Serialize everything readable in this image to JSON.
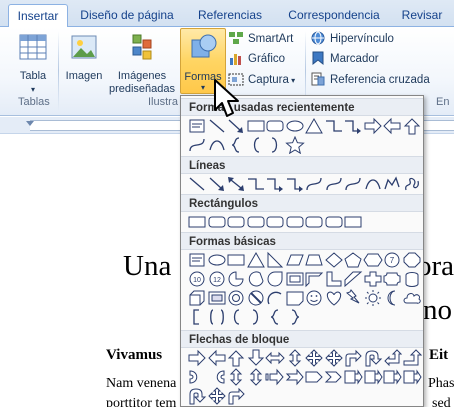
{
  "tabs": [
    {
      "label": "Insertar",
      "active": true
    },
    {
      "label": "Diseño de página"
    },
    {
      "label": "Referencias"
    },
    {
      "label": "Correspondencia"
    },
    {
      "label": "Revisar"
    }
  ],
  "ribbon": {
    "tabla": "Tabla",
    "tablas_group": "Tablas",
    "imagen": "Imagen",
    "imagenes_pred_1": "Imágenes",
    "imagenes_pred_2": "prediseñadas",
    "ilustra_group": "Ilustra",
    "formas": "Formas",
    "smartart": "SmartArt",
    "grafico": "Gráfico",
    "captura": "Captura",
    "hipervinculo": "Hipervínculo",
    "marcador": "Marcador",
    "referencia_cruzada": "Referencia cruzada",
    "en_group": "En"
  },
  "menu": {
    "recientes": "Formas usadas recientemente",
    "lineas": "Líneas",
    "rectangulos": "Rectángulos",
    "basicas": "Formas básicas",
    "flechas": "Flechas de bloque"
  },
  "document": {
    "heading_left": "Una",
    "heading_right": "ora",
    "heading_right2": "no",
    "bold_left": "Vivamus",
    "bold_right": "Eit",
    "body1_left": "Nam venena",
    "body1_right": "Phas",
    "body2_left": "porttitor tem",
    "body2_right": "sed"
  },
  "colors": {
    "accent": "#15428b",
    "highlight": "#ffd563",
    "shape_stroke": "#2c3e6e"
  }
}
